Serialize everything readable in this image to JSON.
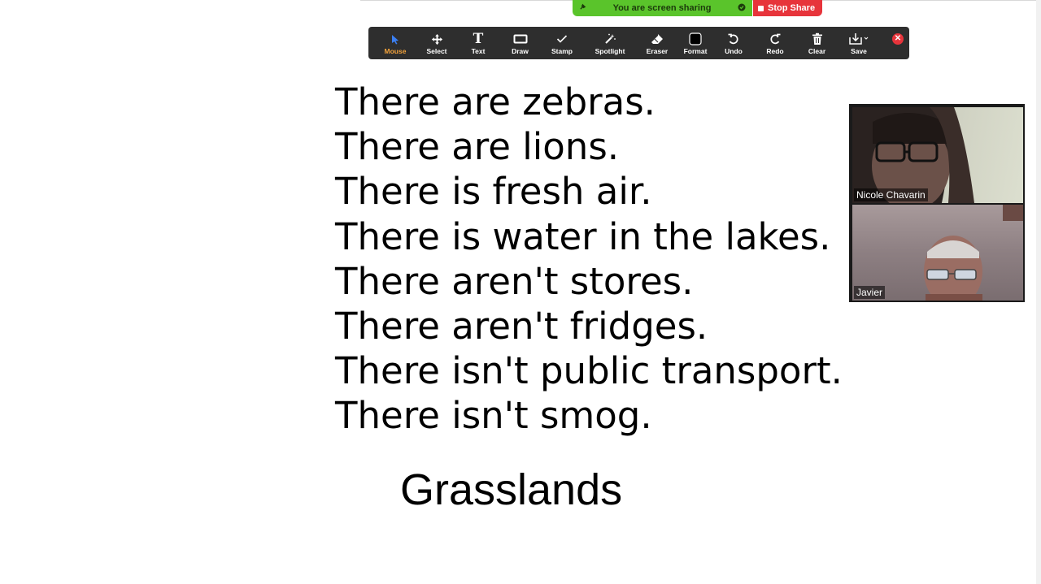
{
  "share_banner": {
    "status_text": "You are screen sharing",
    "stop_label": "Stop Share",
    "status_color": "#5ac42b",
    "stop_color": "#e7343b"
  },
  "toolbar": {
    "tools": [
      {
        "id": "mouse",
        "label": "Mouse",
        "icon": "cursor-arrow-icon",
        "active": true
      },
      {
        "id": "select",
        "label": "Select",
        "icon": "move-arrows-icon",
        "active": false
      },
      {
        "id": "text",
        "label": "Text",
        "icon": "text-t-icon",
        "active": false
      },
      {
        "id": "draw",
        "label": "Draw",
        "icon": "rectangle-icon",
        "active": false
      },
      {
        "id": "stamp",
        "label": "Stamp",
        "icon": "checkmark-icon",
        "active": false
      },
      {
        "id": "spotlight",
        "label": "Spotlight",
        "icon": "magic-wand-icon",
        "active": false
      },
      {
        "id": "eraser",
        "label": "Eraser",
        "icon": "eraser-icon",
        "active": false
      },
      {
        "id": "format",
        "label": "Format",
        "icon": "square-swatch-icon",
        "active": false
      },
      {
        "id": "undo",
        "label": "Undo",
        "icon": "undo-icon",
        "active": false
      },
      {
        "id": "redo",
        "label": "Redo",
        "icon": "redo-icon",
        "active": false
      },
      {
        "id": "clear",
        "label": "Clear",
        "icon": "trash-icon",
        "active": false
      },
      {
        "id": "save",
        "label": "Save",
        "icon": "download-icon",
        "active": false
      }
    ],
    "active_color": "#f2a23c"
  },
  "slide": {
    "sentences": [
      "There are zebras.",
      "There are lions.",
      "There is fresh air.",
      "There is water in the lakes.",
      "There aren't stores.",
      "There aren't fridges.",
      "There isn't public transport.",
      "There isn't smog."
    ],
    "title": "Grasslands"
  },
  "participants": [
    {
      "name": "Nicole Chavarin"
    },
    {
      "name": "Javier"
    }
  ]
}
